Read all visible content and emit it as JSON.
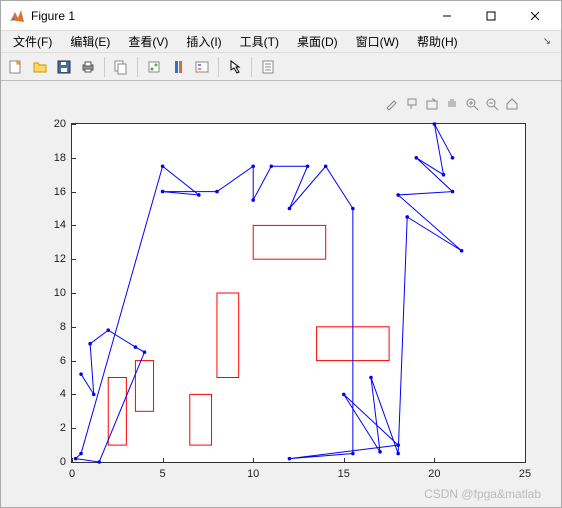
{
  "window": {
    "title": "Figure 1"
  },
  "menu": {
    "file": "文件(F)",
    "edit": "编辑(E)",
    "view": "查看(V)",
    "insert": "插入(I)",
    "tools": "工具(T)",
    "desktop": "桌面(D)",
    "window": "窗口(W)",
    "help": "帮助(H)"
  },
  "toolbar_icons": {
    "new": "new-figure",
    "open": "open",
    "save": "save",
    "print": "print",
    "copy": "copy",
    "link": "link-data",
    "colorbar": "insert-colorbar",
    "legend": "insert-legend",
    "cursor": "edit-plot",
    "props": "property-inspector"
  },
  "axes_toolbar": {
    "brush": "brush",
    "datatips": "data-tips",
    "rotate": "rotate",
    "pan": "pan",
    "zoomin": "zoom-in",
    "zoomout": "zoom-out",
    "home": "restore-view"
  },
  "watermark": "CSDN @fpga&matlab",
  "chart_data": {
    "type": "line",
    "xlim": [
      0,
      25
    ],
    "ylim": [
      0,
      20
    ],
    "xticks": [
      0,
      5,
      10,
      15,
      20,
      25
    ],
    "yticks": [
      0,
      2,
      4,
      6,
      8,
      10,
      12,
      14,
      16,
      18,
      20
    ],
    "series": [
      {
        "name": "path",
        "color": "#0000ff",
        "marker": "dot",
        "x": [
          0.5,
          1.2,
          1.0,
          2.0,
          3.5,
          4.0,
          1.5,
          0.2,
          0.5,
          5.0,
          7.0,
          5.0,
          8.0,
          10.0,
          10.0,
          11.0,
          13.0,
          12.0,
          14.0,
          15.5,
          15.5,
          12.0,
          18.0,
          15.0,
          17.0,
          16.5,
          18.0,
          18.5,
          21.5,
          18.0,
          21.0,
          19.0,
          20.5,
          20.0,
          21.0
        ],
        "y": [
          5.2,
          4.0,
          7.0,
          7.8,
          6.8,
          6.5,
          0.0,
          0.2,
          0.5,
          17.5,
          15.8,
          16.0,
          16.0,
          17.5,
          15.5,
          17.5,
          17.5,
          15.0,
          17.5,
          15.0,
          0.5,
          0.2,
          1.0,
          4.0,
          0.6,
          5.0,
          0.5,
          14.5,
          12.5,
          15.8,
          16.0,
          18.0,
          17.0,
          20.0,
          18.0
        ]
      }
    ],
    "rectangles": [
      {
        "x": 2.0,
        "y": 1.0,
        "w": 1.0,
        "h": 4.0,
        "color": "#ff0000"
      },
      {
        "x": 3.5,
        "y": 3.0,
        "w": 1.0,
        "h": 3.0,
        "color": "#ff0000"
      },
      {
        "x": 6.5,
        "y": 1.0,
        "w": 1.2,
        "h": 3.0,
        "color": "#ff0000"
      },
      {
        "x": 8.0,
        "y": 5.0,
        "w": 1.2,
        "h": 5.0,
        "color": "#ff0000"
      },
      {
        "x": 10.0,
        "y": 12.0,
        "w": 4.0,
        "h": 2.0,
        "color": "#ff0000"
      },
      {
        "x": 13.5,
        "y": 6.0,
        "w": 4.0,
        "h": 2.0,
        "color": "#ff0000"
      }
    ]
  }
}
